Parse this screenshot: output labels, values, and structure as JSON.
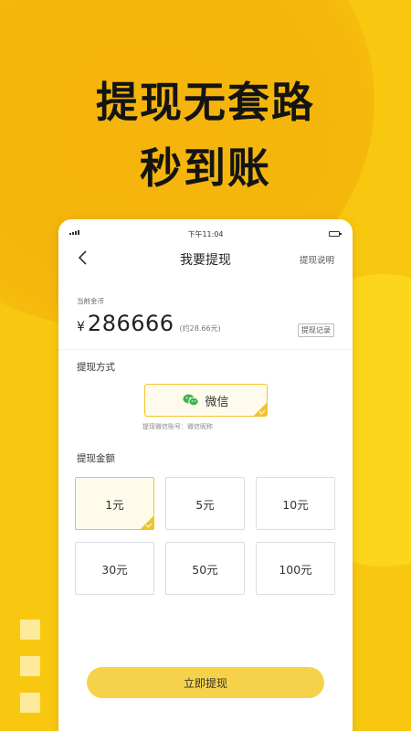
{
  "promo": {
    "headline_line1": "提现无套路",
    "headline_line2": "秒到账"
  },
  "status_bar": {
    "time": "下午11:04"
  },
  "nav": {
    "title": "我要提现",
    "right_link": "提现说明"
  },
  "balance": {
    "label": "当前金币",
    "currency": "¥",
    "amount": "286666",
    "approx": "(约28.66元)",
    "record_button": "提现记录"
  },
  "method": {
    "label": "提现方式",
    "option": "微信",
    "tip": "提现微信账号：微信昵称"
  },
  "amounts": {
    "label": "提现金额",
    "options": [
      "1元",
      "5元",
      "10元",
      "30元",
      "50元",
      "100元"
    ],
    "selected": "1元"
  },
  "submit_button": "立即提现",
  "colors": {
    "background": "#f8c810",
    "accent": "#f0c42a",
    "button": "#f6d24a",
    "wechat_green": "#3fb34f"
  }
}
